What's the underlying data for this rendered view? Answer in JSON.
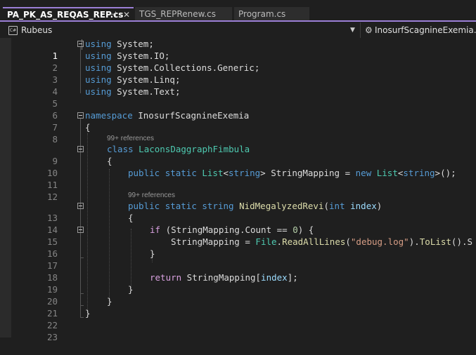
{
  "tabs": [
    {
      "label": "PA_PK_AS_REQAS_REP.cs",
      "active": true
    },
    {
      "label": "TGS_REPRenew.cs",
      "active": false
    },
    {
      "label": "Program.cs",
      "active": false
    }
  ],
  "tab_icons": {
    "pin": "pin-icon",
    "close": "close-icon"
  },
  "navbar": {
    "project_icon_text": "C#",
    "project": "Rubeus",
    "class_path": "InosurfScagnineExemia.Lac"
  },
  "lens": {
    "references_1": "99+ references",
    "references_2": "99+ references"
  },
  "line_numbers": [
    "1",
    "2",
    "3",
    "4",
    "5",
    "6",
    "7",
    "8",
    "9",
    "10",
    "11",
    "12",
    "13",
    "14",
    "15",
    "16",
    "17",
    "18",
    "19",
    "20",
    "21",
    "22",
    "23"
  ],
  "code": {
    "l1": {
      "kw": "using",
      "rest": " System;"
    },
    "l2": {
      "kw": "using",
      "rest": " System.IO;"
    },
    "l3": {
      "kw": "using",
      "rest": " System.Collections.Generic;"
    },
    "l4": {
      "kw": "using",
      "rest": " System.Linq;"
    },
    "l5": {
      "kw": "using",
      "rest": " System.Text;"
    },
    "l7": {
      "kw": "namespace",
      "rest": " InosurfScagnineExemia"
    },
    "l8": {
      "brace": "{"
    },
    "l9": {
      "kw": "class",
      "type": "LaconsDaggraphFimbula"
    },
    "l10": {
      "brace": "{"
    },
    "l11": {
      "kw1": "public",
      "kw2": "static",
      "type1": "List",
      "lt1": "<",
      "kw3": "string",
      "gt1": ">",
      "name": " StringMapping = ",
      "kw4": "new",
      "type2": "List",
      "lt2": "<",
      "kw5": "string",
      "end": ">();"
    },
    "l13": {
      "kw1": "public",
      "kw2": "static",
      "kw3": "string",
      "method": "NidMegalyzedRevi",
      "open": "(",
      "kw4": "int",
      "param": "index",
      "close": ")"
    },
    "l14": {
      "brace": "{"
    },
    "l15": {
      "ctl": "if",
      "a": " (StringMapping.Count == ",
      "num": "0",
      "b": ") {"
    },
    "l16": {
      "a": "StringMapping = ",
      "type": "File",
      "dot1": ".",
      "method1": "ReadAllLines",
      "open": "(",
      "str": "\"debug.log\"",
      "close": ")",
      "dot2": ".",
      "method2": "ToList",
      "tail": "().S"
    },
    "l17": {
      "brace": "}"
    },
    "l19": {
      "ctl": "return",
      "a": " StringMapping[",
      "param": "index",
      "b": "];"
    },
    "l20": {
      "brace": "}"
    },
    "l21": {
      "brace": "}"
    },
    "l22": {
      "brace": "}"
    }
  }
}
